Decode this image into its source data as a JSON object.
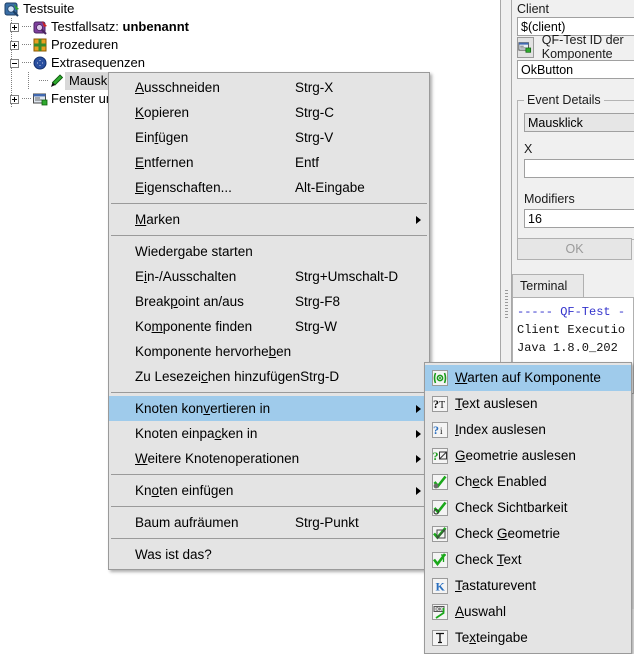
{
  "tree": {
    "items": [
      {
        "label": "Testsuite",
        "icon": "testsuite-icon",
        "depth": 0,
        "handle": "none",
        "bold": false,
        "selected": false
      },
      {
        "label": "Testfallsatz: ",
        "bold_label": "unbenannt",
        "icon": "testset-icon",
        "depth": 1,
        "handle": "plus",
        "bold": true,
        "selected": false
      },
      {
        "label": "Prozeduren",
        "icon": "procedures-icon",
        "depth": 1,
        "handle": "plus",
        "bold": false,
        "selected": false
      },
      {
        "label": "Extrasequenzen",
        "icon": "extrasequences-icon",
        "depth": 1,
        "handle": "minus",
        "bold": false,
        "selected": false
      },
      {
        "label": "Mausklick [OkButton=>$(client)]",
        "icon": "mouseclick-icon",
        "depth": 2,
        "handle": "none",
        "bold": false,
        "selected": true
      },
      {
        "label": "Fenster und Komponenten",
        "icon": "windows-components-icon",
        "depth": 1,
        "handle": "plus",
        "bold": false,
        "selected": false
      }
    ]
  },
  "inspector": {
    "client_label": "Client",
    "client_value": "$(client)",
    "qftest_id_label": "QF-Test ID der Komponente",
    "qftest_id_value": "OkButton",
    "event_details_title": "Event Details",
    "event_type_value": "Mausklick",
    "x_label": "X",
    "x_value": "",
    "modifiers_label": "Modifiers",
    "modifiers_value": "16",
    "ok_button": "OK"
  },
  "terminal": {
    "tab_label": "Terminal",
    "lines": [
      {
        "text": "----- QF-Test -",
        "style": "blue"
      },
      {
        "text": "Client Executio",
        "style": "normal"
      },
      {
        "text": "Java 1.8.0_202",
        "style": "normal"
      }
    ]
  },
  "context_menu": {
    "items": [
      {
        "type": "item",
        "label": "Ausschneiden",
        "mnemonic": "A",
        "accel": "Strg-X",
        "submenu": false,
        "selected": false
      },
      {
        "type": "item",
        "label": "Kopieren",
        "mnemonic": "K",
        "accel": "Strg-C",
        "submenu": false,
        "selected": false
      },
      {
        "type": "item",
        "label": "Einfügen",
        "mnemonic": "f",
        "accel": "Strg-V",
        "submenu": false,
        "selected": false
      },
      {
        "type": "item",
        "label": "Entfernen",
        "mnemonic": "E",
        "accel": "Entf",
        "submenu": false,
        "selected": false
      },
      {
        "type": "item",
        "label": "Eigenschaften...",
        "mnemonic": "E",
        "accel": "Alt-Eingabe",
        "submenu": false,
        "selected": false
      },
      {
        "type": "separator"
      },
      {
        "type": "item",
        "label": "Marken",
        "mnemonic": "M",
        "accel": "",
        "submenu": true,
        "selected": false
      },
      {
        "type": "separator"
      },
      {
        "type": "item",
        "label": "Wiedergabe starten",
        "mnemonic": "",
        "accel": "",
        "submenu": false,
        "selected": false
      },
      {
        "type": "item",
        "label": "Ein-/Ausschalten",
        "mnemonic": "i",
        "accel": "Strg+Umschalt-D",
        "submenu": false,
        "selected": false
      },
      {
        "type": "item",
        "label": "Breakpoint an/aus",
        "mnemonic": "p",
        "accel": "Strg-F8",
        "submenu": false,
        "selected": false
      },
      {
        "type": "item",
        "label": "Komponente finden",
        "mnemonic": "m",
        "accel": "Strg-W",
        "submenu": false,
        "selected": false
      },
      {
        "type": "item",
        "label": "Komponente hervorheben",
        "mnemonic": "b",
        "accel": "",
        "submenu": false,
        "selected": false
      },
      {
        "type": "item",
        "label": "Zu Lesezeichen hinzufügen",
        "mnemonic": "c",
        "accel": "Strg-D",
        "submenu": false,
        "selected": false
      },
      {
        "type": "separator"
      },
      {
        "type": "item",
        "label": "Knoten konvertieren in",
        "mnemonic": "v",
        "accel": "",
        "submenu": true,
        "selected": true
      },
      {
        "type": "item",
        "label": "Knoten einpacken in",
        "mnemonic": "c",
        "accel": "",
        "submenu": true,
        "selected": false
      },
      {
        "type": "item",
        "label": "Weitere Knotenoperationen",
        "mnemonic": "W",
        "accel": "",
        "submenu": true,
        "selected": false
      },
      {
        "type": "separator"
      },
      {
        "type": "item",
        "label": "Knoten einfügen",
        "mnemonic": "o",
        "accel": "",
        "submenu": true,
        "selected": false
      },
      {
        "type": "separator"
      },
      {
        "type": "item",
        "label": "Baum aufräumen",
        "mnemonic": "",
        "accel": "Strg-Punkt",
        "submenu": false,
        "selected": false
      },
      {
        "type": "separator"
      },
      {
        "type": "item",
        "label": "Was ist das?",
        "mnemonic": "",
        "accel": "",
        "submenu": false,
        "selected": false
      }
    ]
  },
  "submenu": {
    "items": [
      {
        "label": "Warten auf Komponente",
        "mnemonic": "W",
        "icon": "wait-for-component-icon",
        "selected": true
      },
      {
        "label": "Text auslesen",
        "mnemonic": "T",
        "icon": "fetch-text-icon",
        "selected": false
      },
      {
        "label": "Index auslesen",
        "mnemonic": "I",
        "icon": "fetch-index-icon",
        "selected": false
      },
      {
        "label": "Geometrie auslesen",
        "mnemonic": "G",
        "icon": "fetch-geometry-icon",
        "selected": false
      },
      {
        "label": "Check Enabled",
        "mnemonic": "e",
        "icon": "check-enabled-icon",
        "selected": false
      },
      {
        "label": "Check Sichtbarkeit",
        "mnemonic": "",
        "icon": "check-visibility-icon",
        "selected": false
      },
      {
        "label": "Check Geometrie",
        "mnemonic": "G",
        "icon": "check-geometry-icon",
        "selected": false
      },
      {
        "label": "Check Text",
        "mnemonic": "T",
        "icon": "check-text-icon",
        "selected": false
      },
      {
        "label": "Tastaturevent",
        "mnemonic": "T",
        "icon": "keyboard-event-icon",
        "selected": false
      },
      {
        "label": "Auswahl",
        "mnemonic": "A",
        "icon": "selection-icon",
        "selected": false
      },
      {
        "label": "Texteingabe",
        "mnemonic": "x",
        "icon": "text-input-icon",
        "selected": false
      }
    ]
  },
  "colors": {
    "menu_background": "#e4e4e4",
    "highlight": "#9fcbeb",
    "panel_background": "#f0f0f0",
    "tree_selection": "#d8d8d8",
    "terminal_blue": "#3333cc"
  }
}
